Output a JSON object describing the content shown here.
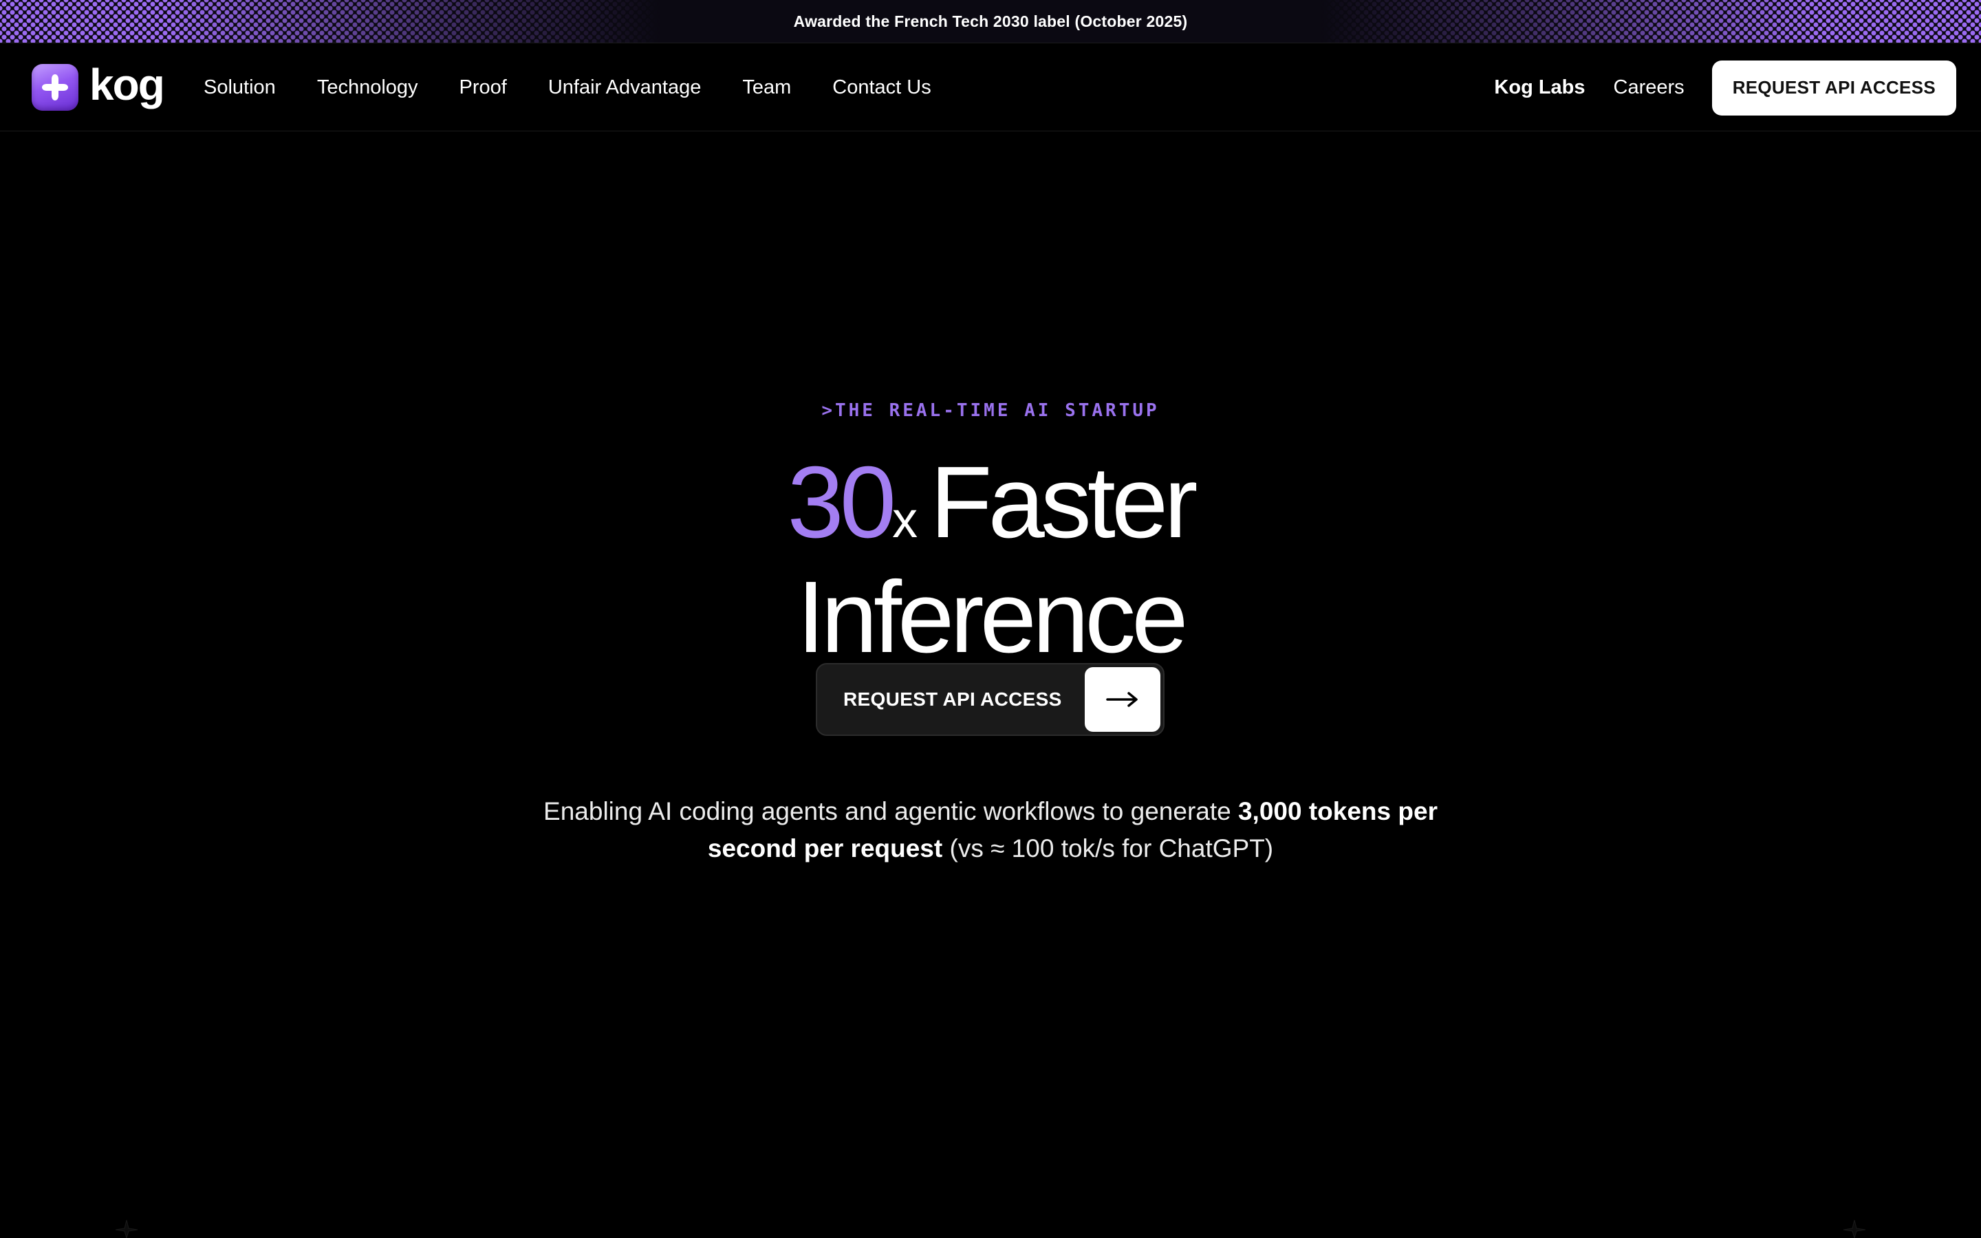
{
  "banner": {
    "text": "Awarded the French Tech 2030 label (October 2025)"
  },
  "brand": {
    "name": "kog",
    "logo_icon": "sparkle-cross-icon",
    "accent": "#a37ef2"
  },
  "nav": {
    "items": [
      {
        "label": "Solution"
      },
      {
        "label": "Technology"
      },
      {
        "label": "Proof"
      },
      {
        "label": "Unfair Advantage"
      },
      {
        "label": "Team"
      },
      {
        "label": "Contact Us"
      }
    ],
    "labs_label": "Kog Labs",
    "careers_label": "Careers",
    "cta_label": "REQUEST API ACCESS"
  },
  "hero": {
    "eyebrow": ">THE REAL-TIME AI STARTUP",
    "headline_number": "30",
    "headline_multiplier": "x",
    "headline_rest": "Faster",
    "headline_line2": "Inference",
    "cta_label": "REQUEST API ACCESS",
    "cta_icon": "arrow-right-icon",
    "sub_part1": "Enabling AI coding agents and agentic workflows to generate ",
    "sub_bold": "3,000 tokens per second per request",
    "sub_part2": " (vs ≈ 100 tok/s for ChatGPT)"
  },
  "colors": {
    "background": "#000000",
    "accent_purple": "#a37ef2",
    "cta_button_bg": "#ffffff"
  }
}
